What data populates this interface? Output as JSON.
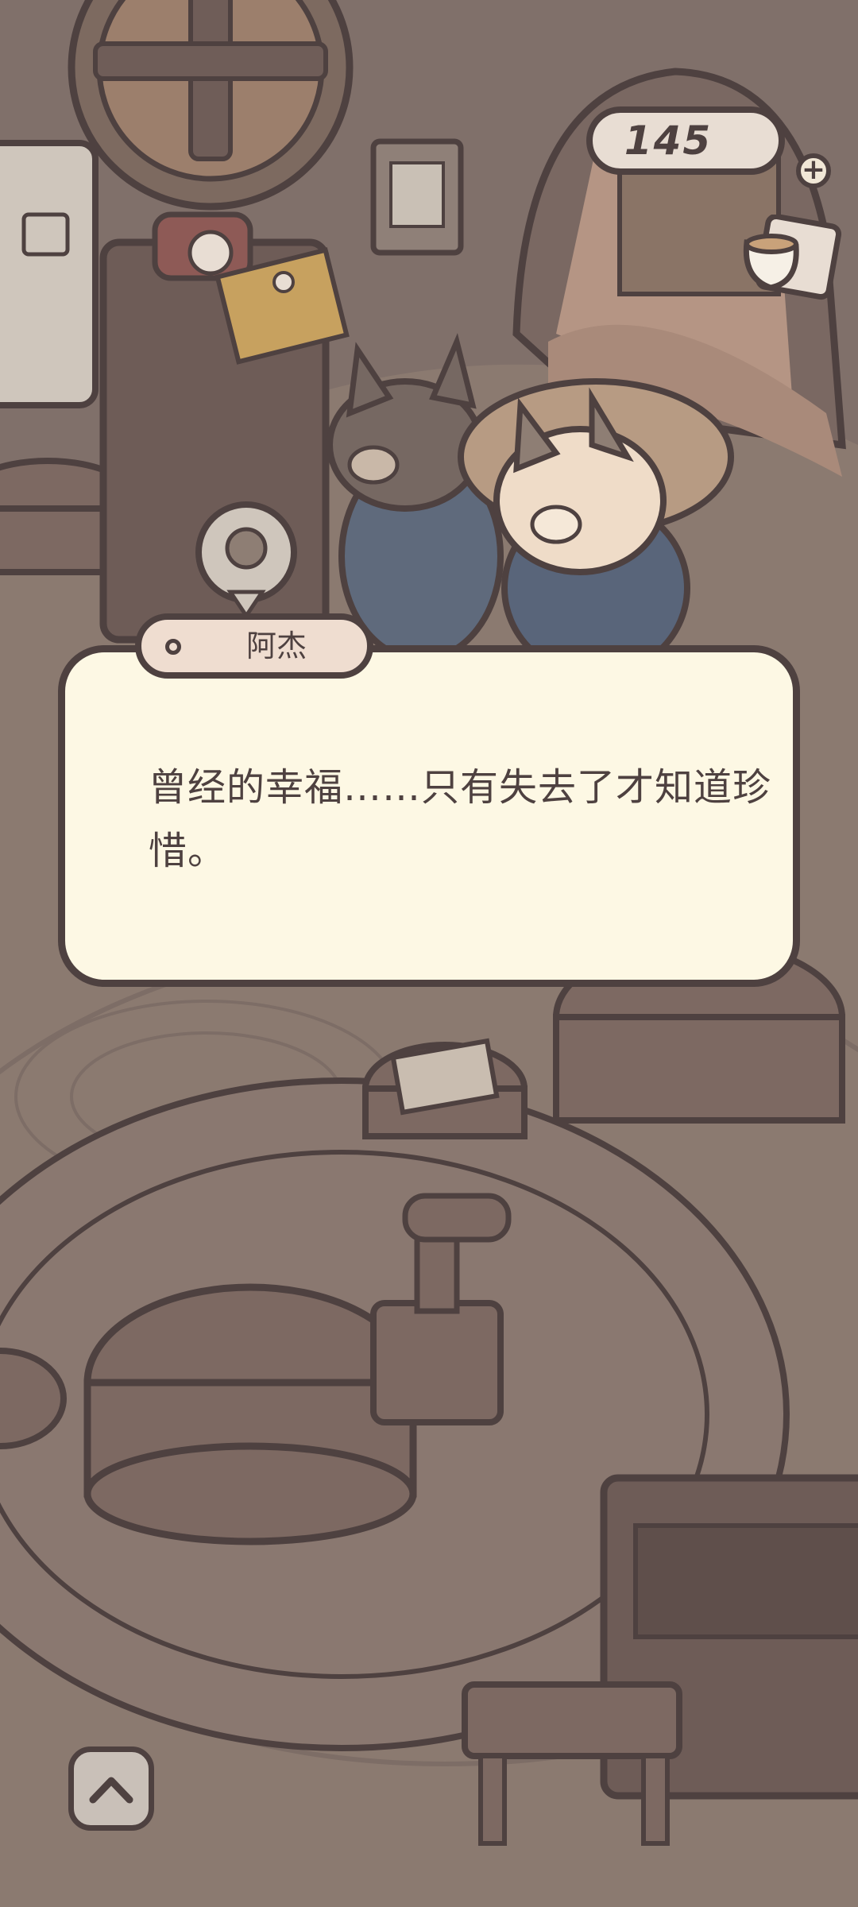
{
  "currency": {
    "value": "145",
    "add_symbol": "+"
  },
  "dialog": {
    "speaker": "阿杰",
    "text": "曾经的幸福……只有失去了才知道珍惜。"
  },
  "icons": {
    "currency_add": "plus-icon",
    "coffee": "coffee-cup-icon",
    "expand": "chevron-up-icon",
    "speaker_marker": "dot-icon"
  },
  "colors": {
    "outline": "#4e4140",
    "dialog_background": "#fdf8e4",
    "scene_background": "#8e7e74"
  }
}
